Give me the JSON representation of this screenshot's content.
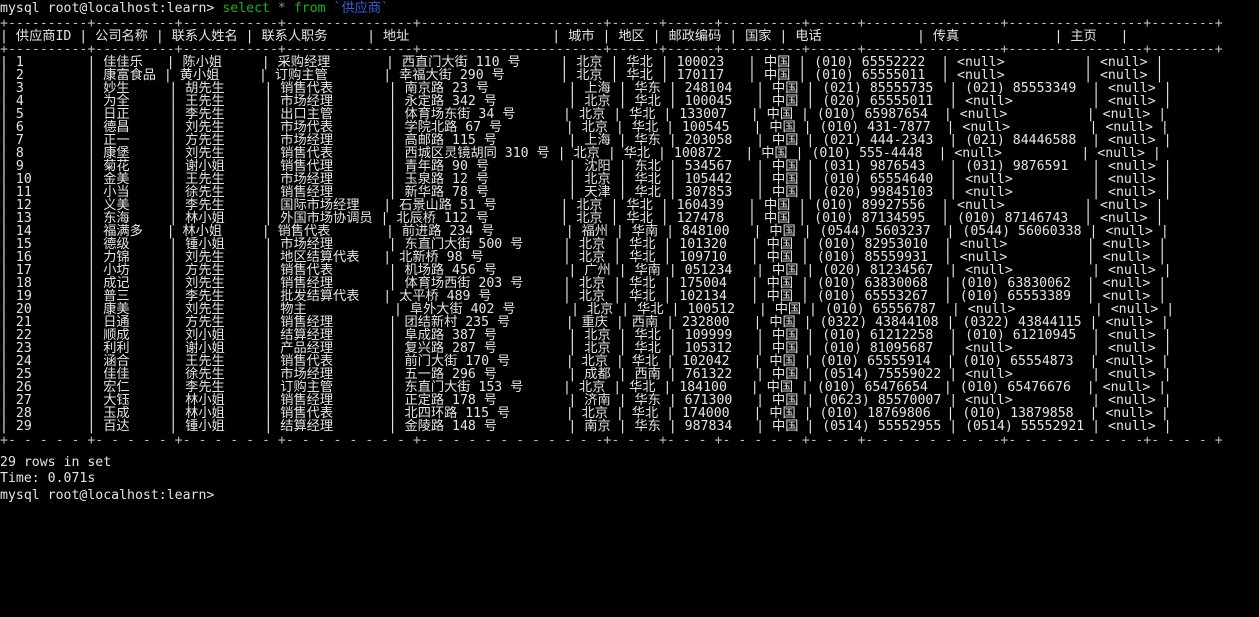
{
  "terminal": {
    "prompt": "mysql root@localhost:learn>",
    "command_keyword1": "select",
    "command_star": "*",
    "command_keyword2": "from",
    "command_table": "`供应商`",
    "colors": {
      "keyword": "#18b218",
      "star": "#8a8a8a",
      "table": "#3b5bdb",
      "text": "#e4e4e4",
      "background": "#000000"
    }
  },
  "table": {
    "columns": [
      {
        "key": "supplier_id",
        "label": "供应商ID",
        "width": 8
      },
      {
        "key": "company",
        "label": "公司名称",
        "width": 8
      },
      {
        "key": "contact_name",
        "label": "联系人姓名",
        "width": 10
      },
      {
        "key": "contact_title",
        "label": "联系人职务",
        "width": 12
      },
      {
        "key": "address",
        "label": "地址",
        "width": 16
      },
      {
        "key": "city",
        "label": "城市",
        "width": 4
      },
      {
        "key": "region",
        "label": "地区",
        "width": 4
      },
      {
        "key": "postal_code",
        "label": "邮政编码",
        "width": 8
      },
      {
        "key": "country",
        "label": "国家",
        "width": 4
      },
      {
        "key": "phone",
        "label": "电话",
        "width": 16
      },
      {
        "key": "fax",
        "label": "传真",
        "width": 16
      },
      {
        "key": "homepage",
        "label": "主页",
        "width": 8
      }
    ],
    "rows": [
      [
        "1",
        "佳佳乐",
        "陈小姐",
        "采购经理",
        "西直门大街 110 号",
        "北京",
        "华北",
        "100023",
        "中国",
        "(010) 65552222",
        "<null>",
        "<null>"
      ],
      [
        "2",
        "康富食品",
        "黄小姐",
        "订购主管",
        "幸福大街 290 号",
        "北京",
        "华北",
        "170117",
        "中国",
        "(010) 65555011",
        "<null>",
        "<null>"
      ],
      [
        "3",
        "妙生",
        "胡先生",
        "销售代表",
        "南京路 23 号",
        "上海",
        "华东",
        "248104",
        "中国",
        "(021) 85555735",
        "(021) 85553349",
        "<null>"
      ],
      [
        "4",
        "为全",
        "王先生",
        "市场经理",
        "永定路 342 号",
        "北京",
        "华北",
        "100045",
        "中国",
        "(020) 65555011",
        "<null>",
        "<null>"
      ],
      [
        "5",
        "日正",
        "李先生",
        "出口主管",
        "体育场东街 34 号",
        "北京",
        "华北",
        "133007",
        "中国",
        "(010) 65987654",
        "<null>",
        "<null>"
      ],
      [
        "6",
        "德昌",
        "刘先生",
        "市场代表",
        "学院北路 67 号",
        "北京",
        "华北",
        "100545",
        "中国",
        "(010) 431-7877",
        "<null>",
        "<null>"
      ],
      [
        "7",
        "正一",
        "方先生",
        "市场经理",
        "高邮路 115 号",
        "上海",
        "华东",
        "203058",
        "中国",
        "(021) 444-2343",
        "(021) 84446588",
        "<null>"
      ],
      [
        "8",
        "康堡",
        "刘先生",
        "销售代表",
        "西城区灵镜胡同 310 号",
        "北京",
        "华北",
        "100872",
        "中国",
        "(010) 555-4448",
        "<null>",
        "<null>"
      ],
      [
        "9",
        "菊花",
        "谢小姐",
        "销售代理",
        "青年路 90 号",
        "沈阳",
        "东北",
        "534567",
        "中国",
        "(031) 9876543",
        "(031) 9876591",
        "<null>"
      ],
      [
        "10",
        "金美",
        "王先生",
        "市场经理",
        "玉泉路 12 号",
        "北京",
        "华北",
        "105442",
        "中国",
        "(010) 65554640",
        "<null>",
        "<null>"
      ],
      [
        "11",
        "小当",
        "徐先生",
        "销售经理",
        "新华路 78 号",
        "天津",
        "华北",
        "307853",
        "中国",
        "(020) 99845103",
        "<null>",
        "<null>"
      ],
      [
        "12",
        "义美",
        "李先生",
        "国际市场经理",
        "石景山路 51 号",
        "北京",
        "华北",
        "160439",
        "中国",
        "(010) 89927556",
        "<null>",
        "<null>"
      ],
      [
        "13",
        "东海",
        "林小姐",
        "外国市场协调员",
        "北辰桥 112 号",
        "北京",
        "华北",
        "127478",
        "中国",
        "(010) 87134595",
        "(010) 87146743",
        "<null>"
      ],
      [
        "14",
        "福满多",
        "林小姐",
        "销售代表",
        "前进路 234 号",
        "福州",
        "华南",
        "848100",
        "中国",
        "(0544) 5603237",
        "(0544) 56060338",
        "<null>"
      ],
      [
        "15",
        "德级",
        "锺小姐",
        "市场经理",
        "东直门大街 500 号",
        "北京",
        "华北",
        "101320",
        "中国",
        "(010) 82953010",
        "<null>",
        "<null>"
      ],
      [
        "16",
        "力锦",
        "刘先生",
        "地区结算代表",
        "北新桥 98 号",
        "北京",
        "华北",
        "109710",
        "中国",
        "(010) 85559931",
        "<null>",
        "<null>"
      ],
      [
        "17",
        "小坊",
        "方先生",
        "销售代表",
        "机场路 456 号",
        "广州",
        "华南",
        "051234",
        "中国",
        "(020) 81234567",
        "<null>",
        "<null>"
      ],
      [
        "18",
        "成记",
        "刘先生",
        "销售经理",
        "体育场西街 203 号",
        "北京",
        "华北",
        "175004",
        "中国",
        "(010) 63830068",
        "(010) 63830062",
        "<null>"
      ],
      [
        "19",
        "普三",
        "李先生",
        "批发结算代表",
        "太平桥 489 号",
        "北京",
        "华北",
        "102134",
        "中国",
        "(010) 65553267",
        "(010) 65553389",
        "<null>"
      ],
      [
        "20",
        "康美",
        "刘先生",
        "物主",
        "阜外大街 402 号",
        "北京",
        "华北",
        "100512",
        "中国",
        "(010) 65556787",
        "<null>",
        "<null>"
      ],
      [
        "21",
        "日通",
        "方先生",
        "销售经理",
        "团结新村 235 号",
        "重庆",
        "西南",
        "232800",
        "中国",
        "(0322) 43844108",
        "(0322) 43844115",
        "<null>"
      ],
      [
        "22",
        "顺成",
        "刘小姐",
        "结算经理",
        "阜成路 387 号",
        "北京",
        "华北",
        "109999",
        "中国",
        "(010) 61212258",
        "(010) 61210945",
        "<null>"
      ],
      [
        "23",
        "利利",
        "谢小姐",
        "产品经理",
        "复兴路 287 号",
        "北京",
        "华北",
        "105312",
        "中国",
        "(010) 81095687",
        "<null>",
        "<null>"
      ],
      [
        "24",
        "涵合",
        "王先生",
        "销售代表",
        "前门大街 170 号",
        "北京",
        "华北",
        "102042",
        "中国",
        "(010) 65555914",
        "(010) 65554873",
        "<null>"
      ],
      [
        "25",
        "佳佳",
        "徐先生",
        "市场经理",
        "五一路 296 号",
        "成都",
        "西南",
        "761322",
        "中国",
        "(0514) 75559022",
        "<null>",
        "<null>"
      ],
      [
        "26",
        "宏仁",
        "李先生",
        "订购主管",
        "东直门大街 153 号",
        "北京",
        "华北",
        "184100",
        "中国",
        "(010) 65476654",
        "(010) 65476676",
        "<null>"
      ],
      [
        "27",
        "大钰",
        "林小姐",
        "销售经理",
        "正定路 178 号",
        "济南",
        "华东",
        "671300",
        "中国",
        "(0623) 85570007",
        "<null>",
        "<null>"
      ],
      [
        "28",
        "玉成",
        "林小姐",
        "销售代表",
        "北四环路 115 号",
        "北京",
        "华北",
        "174000",
        "中国",
        "(010) 18769806",
        "(010) 13879858",
        "<null>"
      ],
      [
        "29",
        "百达",
        "锺小姐",
        "结算经理",
        "金陵路 148 号",
        "南京",
        "华东",
        "987834",
        "中国",
        "(0514) 55552955",
        "(0514) 55552921",
        "<null>"
      ]
    ]
  },
  "footer": {
    "rows_in_set": "29 rows in set",
    "time": "Time: 0.071s",
    "final_prompt": "mysql root@localhost:learn>"
  }
}
